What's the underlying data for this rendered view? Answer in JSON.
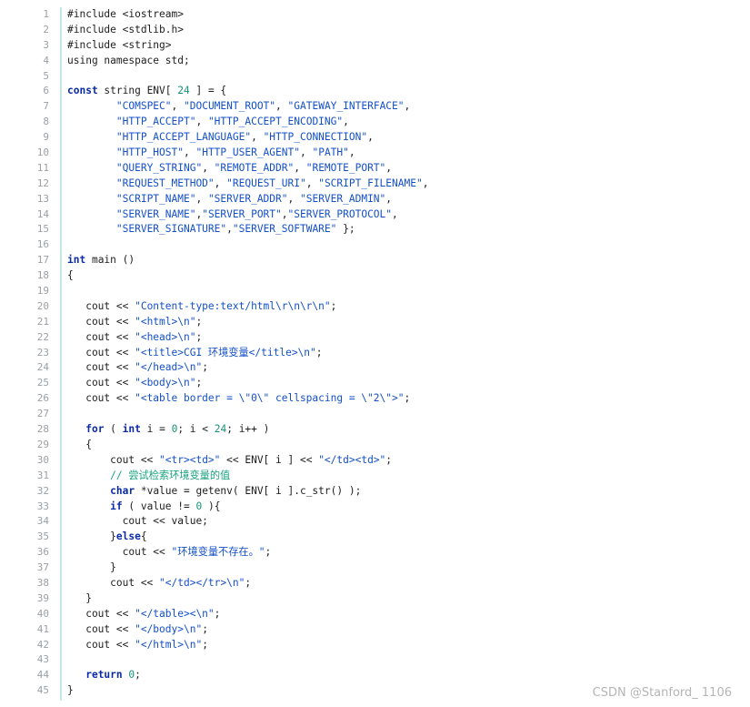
{
  "colors": {
    "keyword": "#0b2aa8",
    "string": "#1450c8",
    "number": "#17937a",
    "comment": "#18a37f",
    "text": "#1e1e1e",
    "line_number": "#9aa0a6",
    "gutter_border": "#c5e6e1",
    "watermark": "#b5b5b5"
  },
  "watermark": "CSDN @Stanford_ 1106",
  "lines": [
    {
      "n": "1",
      "tokens": [
        {
          "t": "pre",
          "v": "#include <iostream>"
        }
      ]
    },
    {
      "n": "2",
      "tokens": [
        {
          "t": "pre",
          "v": "#include <stdlib.h>"
        }
      ]
    },
    {
      "n": "3",
      "tokens": [
        {
          "t": "pre",
          "v": "#include <string>"
        }
      ]
    },
    {
      "n": "4",
      "tokens": [
        {
          "t": "txt",
          "v": "using namespace std;"
        }
      ]
    },
    {
      "n": "5",
      "tokens": []
    },
    {
      "n": "6",
      "tokens": [
        {
          "t": "kw",
          "v": "const"
        },
        {
          "t": "txt",
          "v": " string ENV[ "
        },
        {
          "t": "num",
          "v": "24"
        },
        {
          "t": "txt",
          "v": " ] = {"
        }
      ]
    },
    {
      "n": "7",
      "tokens": [
        {
          "t": "txt",
          "v": "        "
        },
        {
          "t": "str",
          "v": "\"COMSPEC\""
        },
        {
          "t": "txt",
          "v": ", "
        },
        {
          "t": "str",
          "v": "\"DOCUMENT_ROOT\""
        },
        {
          "t": "txt",
          "v": ", "
        },
        {
          "t": "str",
          "v": "\"GATEWAY_INTERFACE\""
        },
        {
          "t": "txt",
          "v": ","
        }
      ]
    },
    {
      "n": "8",
      "tokens": [
        {
          "t": "txt",
          "v": "        "
        },
        {
          "t": "str",
          "v": "\"HTTP_ACCEPT\""
        },
        {
          "t": "txt",
          "v": ", "
        },
        {
          "t": "str",
          "v": "\"HTTP_ACCEPT_ENCODING\""
        },
        {
          "t": "txt",
          "v": ","
        }
      ]
    },
    {
      "n": "9",
      "tokens": [
        {
          "t": "txt",
          "v": "        "
        },
        {
          "t": "str",
          "v": "\"HTTP_ACCEPT_LANGUAGE\""
        },
        {
          "t": "txt",
          "v": ", "
        },
        {
          "t": "str",
          "v": "\"HTTP_CONNECTION\""
        },
        {
          "t": "txt",
          "v": ","
        }
      ]
    },
    {
      "n": "10",
      "tokens": [
        {
          "t": "txt",
          "v": "        "
        },
        {
          "t": "str",
          "v": "\"HTTP_HOST\""
        },
        {
          "t": "txt",
          "v": ", "
        },
        {
          "t": "str",
          "v": "\"HTTP_USER_AGENT\""
        },
        {
          "t": "txt",
          "v": ", "
        },
        {
          "t": "str",
          "v": "\"PATH\""
        },
        {
          "t": "txt",
          "v": ","
        }
      ]
    },
    {
      "n": "11",
      "tokens": [
        {
          "t": "txt",
          "v": "        "
        },
        {
          "t": "str",
          "v": "\"QUERY_STRING\""
        },
        {
          "t": "txt",
          "v": ", "
        },
        {
          "t": "str",
          "v": "\"REMOTE_ADDR\""
        },
        {
          "t": "txt",
          "v": ", "
        },
        {
          "t": "str",
          "v": "\"REMOTE_PORT\""
        },
        {
          "t": "txt",
          "v": ","
        }
      ]
    },
    {
      "n": "12",
      "tokens": [
        {
          "t": "txt",
          "v": "        "
        },
        {
          "t": "str",
          "v": "\"REQUEST_METHOD\""
        },
        {
          "t": "txt",
          "v": ", "
        },
        {
          "t": "str",
          "v": "\"REQUEST_URI\""
        },
        {
          "t": "txt",
          "v": ", "
        },
        {
          "t": "str",
          "v": "\"SCRIPT_FILENAME\""
        },
        {
          "t": "txt",
          "v": ","
        }
      ]
    },
    {
      "n": "13",
      "tokens": [
        {
          "t": "txt",
          "v": "        "
        },
        {
          "t": "str",
          "v": "\"SCRIPT_NAME\""
        },
        {
          "t": "txt",
          "v": ", "
        },
        {
          "t": "str",
          "v": "\"SERVER_ADDR\""
        },
        {
          "t": "txt",
          "v": ", "
        },
        {
          "t": "str",
          "v": "\"SERVER_ADMIN\""
        },
        {
          "t": "txt",
          "v": ","
        }
      ]
    },
    {
      "n": "14",
      "tokens": [
        {
          "t": "txt",
          "v": "        "
        },
        {
          "t": "str",
          "v": "\"SERVER_NAME\""
        },
        {
          "t": "txt",
          "v": ","
        },
        {
          "t": "str",
          "v": "\"SERVER_PORT\""
        },
        {
          "t": "txt",
          "v": ","
        },
        {
          "t": "str",
          "v": "\"SERVER_PROTOCOL\""
        },
        {
          "t": "txt",
          "v": ","
        }
      ]
    },
    {
      "n": "15",
      "tokens": [
        {
          "t": "txt",
          "v": "        "
        },
        {
          "t": "str",
          "v": "\"SERVER_SIGNATURE\""
        },
        {
          "t": "txt",
          "v": ","
        },
        {
          "t": "str",
          "v": "\"SERVER_SOFTWARE\""
        },
        {
          "t": "txt",
          "v": " };"
        }
      ]
    },
    {
      "n": "16",
      "tokens": []
    },
    {
      "n": "17",
      "tokens": [
        {
          "t": "kw",
          "v": "int"
        },
        {
          "t": "txt",
          "v": " main ()"
        }
      ]
    },
    {
      "n": "18",
      "tokens": [
        {
          "t": "txt",
          "v": "{"
        }
      ]
    },
    {
      "n": "19",
      "tokens": []
    },
    {
      "n": "20",
      "tokens": [
        {
          "t": "txt",
          "v": "   cout << "
        },
        {
          "t": "str",
          "v": "\"Content-type:text/html\\r\\n\\r\\n\""
        },
        {
          "t": "txt",
          "v": ";"
        }
      ]
    },
    {
      "n": "21",
      "tokens": [
        {
          "t": "txt",
          "v": "   cout << "
        },
        {
          "t": "str",
          "v": "\"<html>\\n\""
        },
        {
          "t": "txt",
          "v": ";"
        }
      ]
    },
    {
      "n": "22",
      "tokens": [
        {
          "t": "txt",
          "v": "   cout << "
        },
        {
          "t": "str",
          "v": "\"<head>\\n\""
        },
        {
          "t": "txt",
          "v": ";"
        }
      ]
    },
    {
      "n": "23",
      "tokens": [
        {
          "t": "txt",
          "v": "   cout << "
        },
        {
          "t": "str",
          "v": "\"<title>CGI 环境变量</title>\\n\""
        },
        {
          "t": "txt",
          "v": ";"
        }
      ]
    },
    {
      "n": "24",
      "tokens": [
        {
          "t": "txt",
          "v": "   cout << "
        },
        {
          "t": "str",
          "v": "\"</head>\\n\""
        },
        {
          "t": "txt",
          "v": ";"
        }
      ]
    },
    {
      "n": "25",
      "tokens": [
        {
          "t": "txt",
          "v": "   cout << "
        },
        {
          "t": "str",
          "v": "\"<body>\\n\""
        },
        {
          "t": "txt",
          "v": ";"
        }
      ]
    },
    {
      "n": "26",
      "tokens": [
        {
          "t": "txt",
          "v": "   cout << "
        },
        {
          "t": "str",
          "v": "\"<table border = \\\"0\\\" cellspacing = \\\"2\\\">\""
        },
        {
          "t": "txt",
          "v": ";"
        }
      ]
    },
    {
      "n": "27",
      "tokens": []
    },
    {
      "n": "28",
      "tokens": [
        {
          "t": "txt",
          "v": "   "
        },
        {
          "t": "kw",
          "v": "for"
        },
        {
          "t": "txt",
          "v": " ( "
        },
        {
          "t": "kw",
          "v": "int"
        },
        {
          "t": "txt",
          "v": " i = "
        },
        {
          "t": "num",
          "v": "0"
        },
        {
          "t": "txt",
          "v": "; i < "
        },
        {
          "t": "num",
          "v": "24"
        },
        {
          "t": "txt",
          "v": "; i++ )"
        }
      ]
    },
    {
      "n": "29",
      "tokens": [
        {
          "t": "txt",
          "v": "   {"
        }
      ]
    },
    {
      "n": "30",
      "tokens": [
        {
          "t": "txt",
          "v": "       cout << "
        },
        {
          "t": "str",
          "v": "\"<tr><td>\""
        },
        {
          "t": "txt",
          "v": " << ENV[ i ] << "
        },
        {
          "t": "str",
          "v": "\"</td><td>\""
        },
        {
          "t": "txt",
          "v": ";"
        }
      ]
    },
    {
      "n": "31",
      "tokens": [
        {
          "t": "txt",
          "v": "       "
        },
        {
          "t": "com",
          "v": "// 尝试检索环境变量的值"
        }
      ]
    },
    {
      "n": "32",
      "tokens": [
        {
          "t": "txt",
          "v": "       "
        },
        {
          "t": "kw",
          "v": "char"
        },
        {
          "t": "txt",
          "v": " *value = getenv( ENV[ i ].c_str() );"
        }
      ]
    },
    {
      "n": "33",
      "tokens": [
        {
          "t": "txt",
          "v": "       "
        },
        {
          "t": "kw",
          "v": "if"
        },
        {
          "t": "txt",
          "v": " ( value != "
        },
        {
          "t": "num",
          "v": "0"
        },
        {
          "t": "txt",
          "v": " ){"
        }
      ]
    },
    {
      "n": "34",
      "tokens": [
        {
          "t": "txt",
          "v": "         cout << value;"
        }
      ]
    },
    {
      "n": "35",
      "tokens": [
        {
          "t": "txt",
          "v": "       }"
        },
        {
          "t": "kw",
          "v": "else"
        },
        {
          "t": "txt",
          "v": "{"
        }
      ]
    },
    {
      "n": "36",
      "tokens": [
        {
          "t": "txt",
          "v": "         cout << "
        },
        {
          "t": "str",
          "v": "\"环境变量不存在。\""
        },
        {
          "t": "txt",
          "v": ";"
        }
      ]
    },
    {
      "n": "37",
      "tokens": [
        {
          "t": "txt",
          "v": "       }"
        }
      ]
    },
    {
      "n": "38",
      "tokens": [
        {
          "t": "txt",
          "v": "       cout << "
        },
        {
          "t": "str",
          "v": "\"</td></tr>\\n\""
        },
        {
          "t": "txt",
          "v": ";"
        }
      ]
    },
    {
      "n": "39",
      "tokens": [
        {
          "t": "txt",
          "v": "   }"
        }
      ]
    },
    {
      "n": "40",
      "tokens": [
        {
          "t": "txt",
          "v": "   cout << "
        },
        {
          "t": "str",
          "v": "\"</table><\\n\""
        },
        {
          "t": "txt",
          "v": ";"
        }
      ]
    },
    {
      "n": "41",
      "tokens": [
        {
          "t": "txt",
          "v": "   cout << "
        },
        {
          "t": "str",
          "v": "\"</body>\\n\""
        },
        {
          "t": "txt",
          "v": ";"
        }
      ]
    },
    {
      "n": "42",
      "tokens": [
        {
          "t": "txt",
          "v": "   cout << "
        },
        {
          "t": "str",
          "v": "\"</html>\\n\""
        },
        {
          "t": "txt",
          "v": ";"
        }
      ]
    },
    {
      "n": "43",
      "tokens": []
    },
    {
      "n": "44",
      "tokens": [
        {
          "t": "txt",
          "v": "   "
        },
        {
          "t": "kw",
          "v": "return"
        },
        {
          "t": "txt",
          "v": " "
        },
        {
          "t": "num",
          "v": "0"
        },
        {
          "t": "txt",
          "v": ";"
        }
      ]
    },
    {
      "n": "45",
      "tokens": [
        {
          "t": "txt",
          "v": "}"
        }
      ]
    }
  ]
}
